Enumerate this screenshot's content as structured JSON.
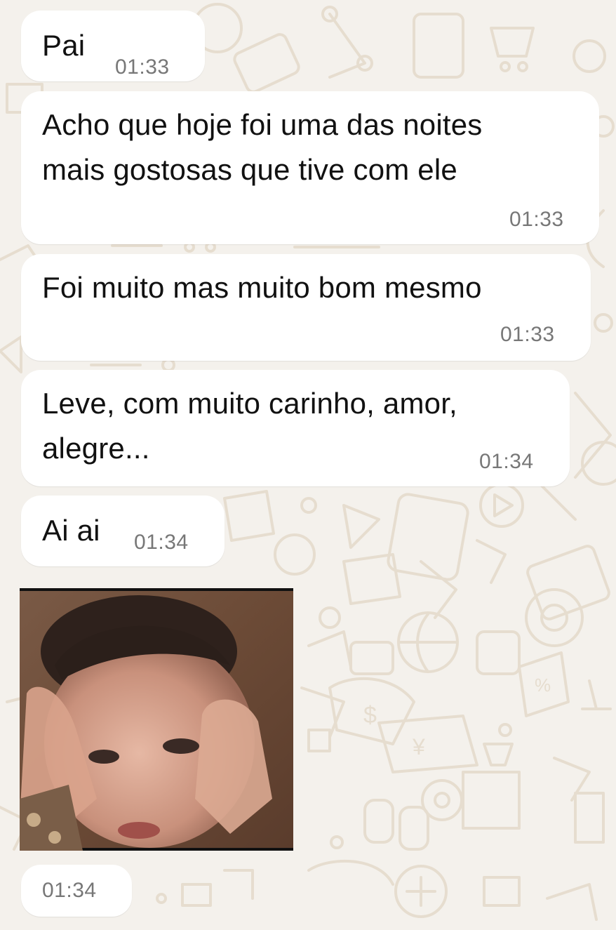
{
  "messages": [
    {
      "text": "Pai",
      "time": "01:33"
    },
    {
      "text": "Acho que hoje foi uma das noites\nmais gostosas que tive com ele",
      "time": "01:33"
    },
    {
      "text": "Foi muito mas muito bom mesmo",
      "time": "01:33"
    },
    {
      "text": "Leve, com muito carinho, amor,\nalegre...",
      "time": "01:34"
    },
    {
      "text": "Ai ai",
      "time": "01:34"
    }
  ],
  "media_message": {
    "time": "01:34"
  },
  "colors": {
    "background": "#f4f1ec",
    "bubble": "#ffffff",
    "text": "#111111",
    "timestamp": "#777777"
  }
}
